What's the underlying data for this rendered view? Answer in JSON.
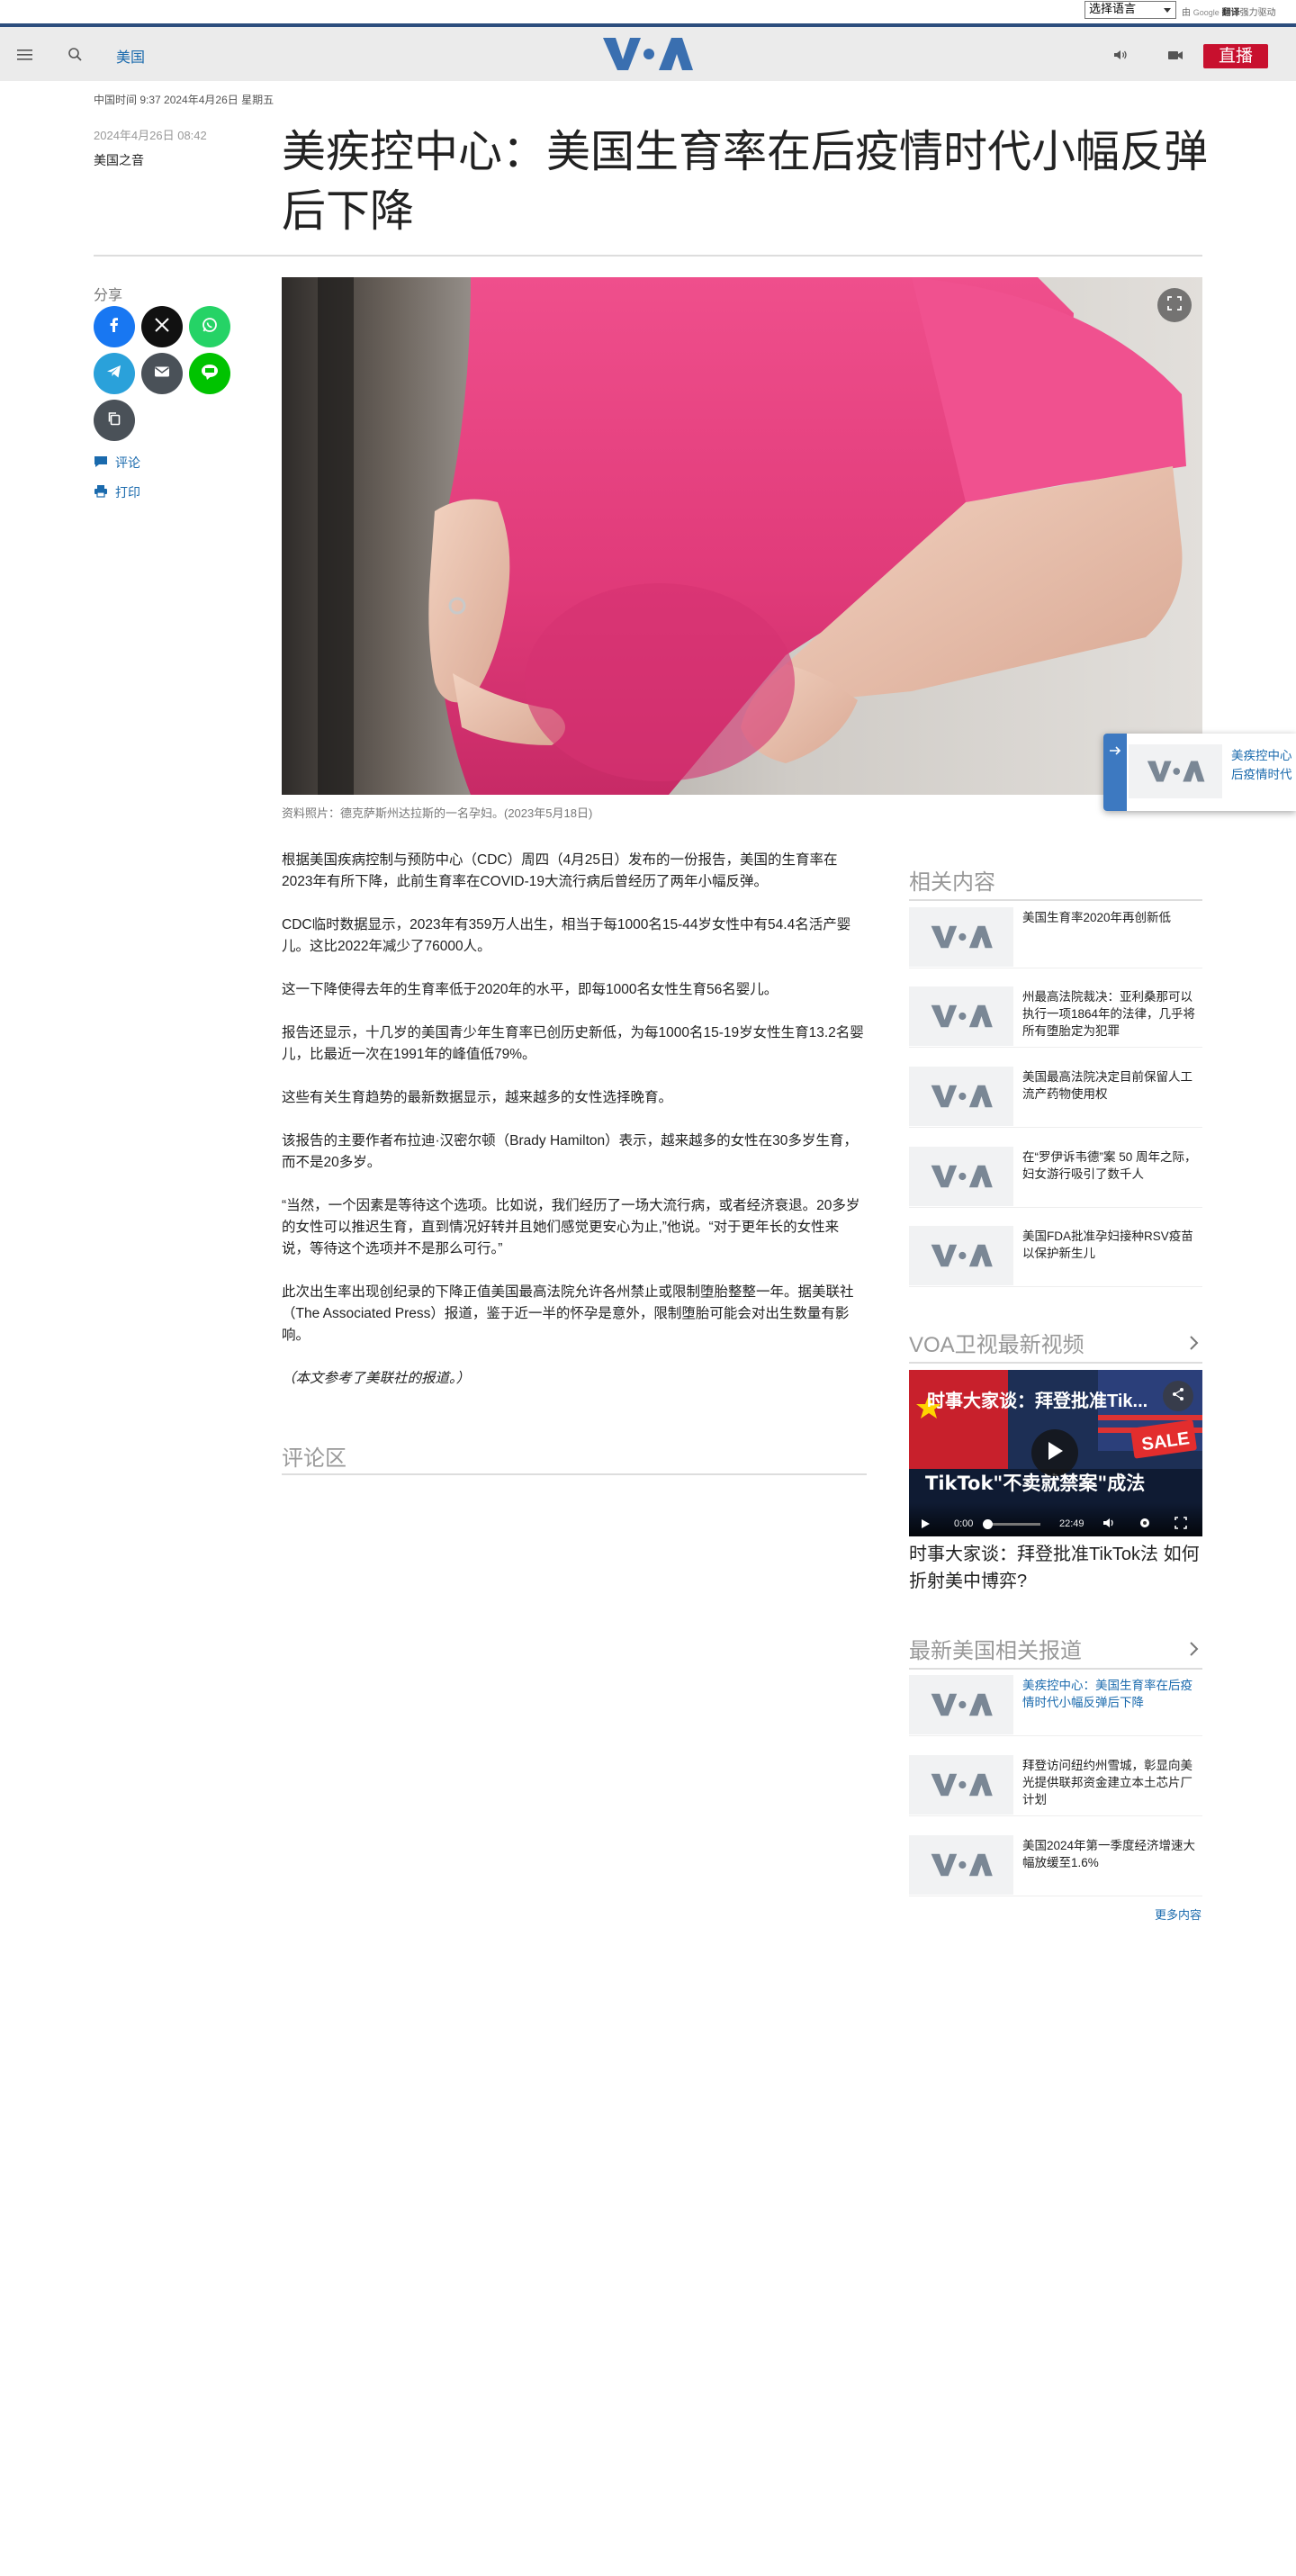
{
  "translate": {
    "select_value": "选择语言",
    "powered_prefix": "由",
    "google": "Google",
    "translate_word": "翻译",
    "powered_suffix": "强力驱动"
  },
  "header": {
    "section": "美国",
    "live_label": "直播",
    "logo_text": "VOA"
  },
  "article": {
    "datetime_line": "中国时间 9:37 2024年4月26日 星期五",
    "pubdate": "2024年4月26日 08:42",
    "author": "美国之音",
    "title": "美疾控中心：美国生育率在后疫情时代小幅反弹后下降",
    "caption": "资料照片：德克萨斯州达拉斯的一名孕妇。(2023年5月18日)",
    "paragraphs": [
      "根据美国疾病控制与预防中心（CDC）周四（4月25日）发布的一份报告，美国的生育率在2023年有所下降，此前生育率在COVID-19大流行病后曾经历了两年小幅反弹。",
      "CDC临时数据显示，2023年有359万人出生，相当于每1000名15-44岁女性中有54.4名活产婴儿。这比2022年减少了76000人。",
      "这一下降使得去年的生育率低于2020年的水平，即每1000名女性生育56名婴儿。",
      "报告还显示，十几岁的美国青少年生育率已创历史新低，为每1000名15-19岁女性生育13.2名婴儿，比最近一次在1991年的峰值低79%。",
      "这些有关生育趋势的最新数据显示，越来越多的女性选择晚育。",
      "该报告的主要作者布拉迪·汉密尔顿（Brady Hamilton）表示，越来越多的女性在30多岁生育，而不是20多岁。",
      "“当然，一个因素是等待这个选项。比如说，我们经历了一场大流行病，或者经济衰退。20多岁的女性可以推迟生育，直到情况好转并且她们感觉更安心为止,”他说。“对于更年长的女性来说，等待这个选项并不是那么可行。”",
      "此次出生率出现创纪录的下降正值美国最高法院允许各州禁止或限制堕胎整整一年。据美联社（The Associated Press）报道，鉴于近一半的怀孕是意外，限制堕胎可能会对出生数量有影响。"
    ],
    "note": "（本文参考了美联社的报道。）",
    "comments_title": "评论区"
  },
  "share": {
    "label": "分享",
    "comment_link": "评论",
    "print_link": "打印"
  },
  "related": {
    "heading": "相关内容",
    "items": [
      "美国生育率2020年再创新低",
      "州最高法院裁决：亚利桑那可以执行一项1864年的法律，几乎将所有堕胎定为犯罪",
      "美国最高法院决定目前保留人工流产药物使用权",
      "在“罗伊诉韦德”案 50 周年之际，妇女游行吸引了数千人",
      "美国FDA批准孕妇接种RSV疫苗以保护新生儿"
    ]
  },
  "video": {
    "heading": "VOA卫视最新视频",
    "overlay_title": "时事大家谈：拜登批准Tik...",
    "current_time": "0:00",
    "duration": "22:49",
    "caption": "时事大家谈：拜登批准TikTok法 如何折射美中博弈?"
  },
  "latest": {
    "heading": "最新美国相关报道",
    "items": [
      "美疾控中心：美国生育率在后疫情时代小幅反弹后下降",
      "拜登访问纽约州雪城，彰显向美光提供联邦资金建立本土芯片厂计划",
      "美国2024年第一季度经济增速大幅放缓至1.6%"
    ],
    "more": "更多内容"
  },
  "floater": {
    "line1": "美疾控中心",
    "line2": "后疫情时代"
  },
  "colors": {
    "accent_blue": "#1a6aad",
    "live_red": "#c8102e",
    "header_bar": "#2c4d7d",
    "logo_blue": "#3a6fb0"
  }
}
